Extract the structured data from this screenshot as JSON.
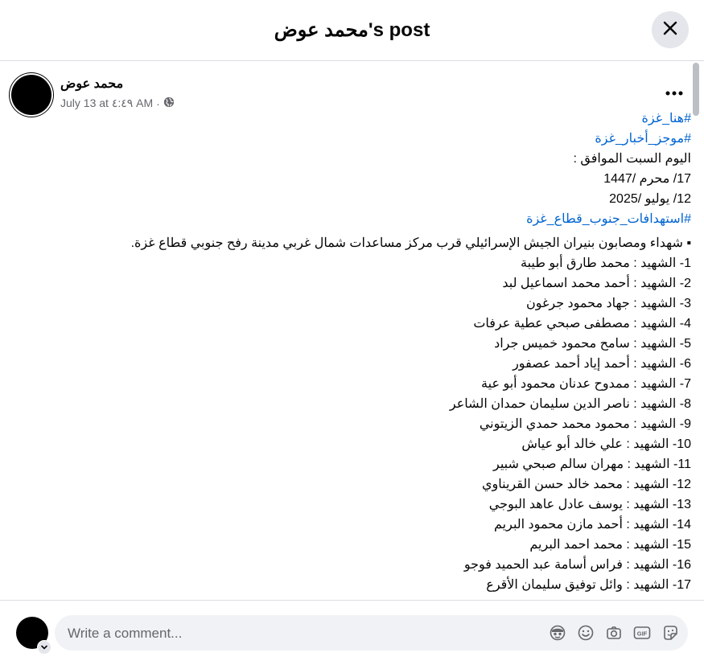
{
  "header": {
    "title": "محمد عوض's post"
  },
  "post": {
    "author": "محمد عوض",
    "timestamp": "July 13 at ٤:٤٩ AM",
    "meta_sep": "·",
    "hashtags_top": [
      "#هنا_غزة",
      "#موجز_أخبار_غزة"
    ],
    "date_lines": [
      "اليوم السبت الموافق :",
      "17/ محرم /1447",
      "12/ يوليو /2025"
    ],
    "hashtag_section": "#استهدافات_جنوب_قطاع_غزة",
    "lead": "▪︎ شهداء ومصابون بنيران الجيش الإسرائيلي قرب مركز مساعدات شمال غربي مدينة رفح جنوبي قطاع غزة.",
    "martyrs": [
      "1- الشهيد : محمد طارق أبو طيبة",
      "2- الشهيد : أحمد محمد اسماعيل لبد",
      "3- الشهيد : جهاد محمود جرغون",
      "4- الشهيد : مصطفى صبحي عطية عرفات",
      "5- الشهيد : سامح محمود خميس جراد",
      "6- الشهيد : أحمد إياد أحمد عصفور",
      "7- الشهيد : ممدوح عدنان محمود أبو عية",
      "8- الشهيد : ناصر الدين سليمان حمدان الشاعر",
      "9- الشهيد : محمود محمد حمدي الزيتوني",
      "10- الشهيد : علي خالد أبو عياش",
      "11- الشهيد : مهران سالم صبحي شبير",
      "12- الشهيد : محمد خالد حسن القريناوي",
      "13- الشهيد : يوسف عادل عاهد البوجي",
      "14- الشهيد : أحمد مازن محمود البريم",
      "15- الشهيد : محمد احمد البريم",
      "16- الشهيد : فراس أسامة عبد الحميد فوجو",
      "17- الشهيد : وائل توفيق سليمان الأقرع"
    ]
  },
  "comment": {
    "placeholder": "Write a comment..."
  },
  "icons": {
    "close": "close-icon",
    "more": "more-options-icon",
    "privacy": "globe-icon",
    "avatar_menu": "chevron-down-icon",
    "avatar_sticker": "avatar-sticker-icon",
    "emoji": "emoji-icon",
    "camera": "camera-icon",
    "gif": "gif-icon",
    "sticker": "sticker-icon"
  },
  "colors": {
    "link": "#0064d1",
    "meta": "#65676b",
    "text": "#050505",
    "input_bg": "#f0f2f5",
    "button_bg": "#e4e6eb"
  }
}
